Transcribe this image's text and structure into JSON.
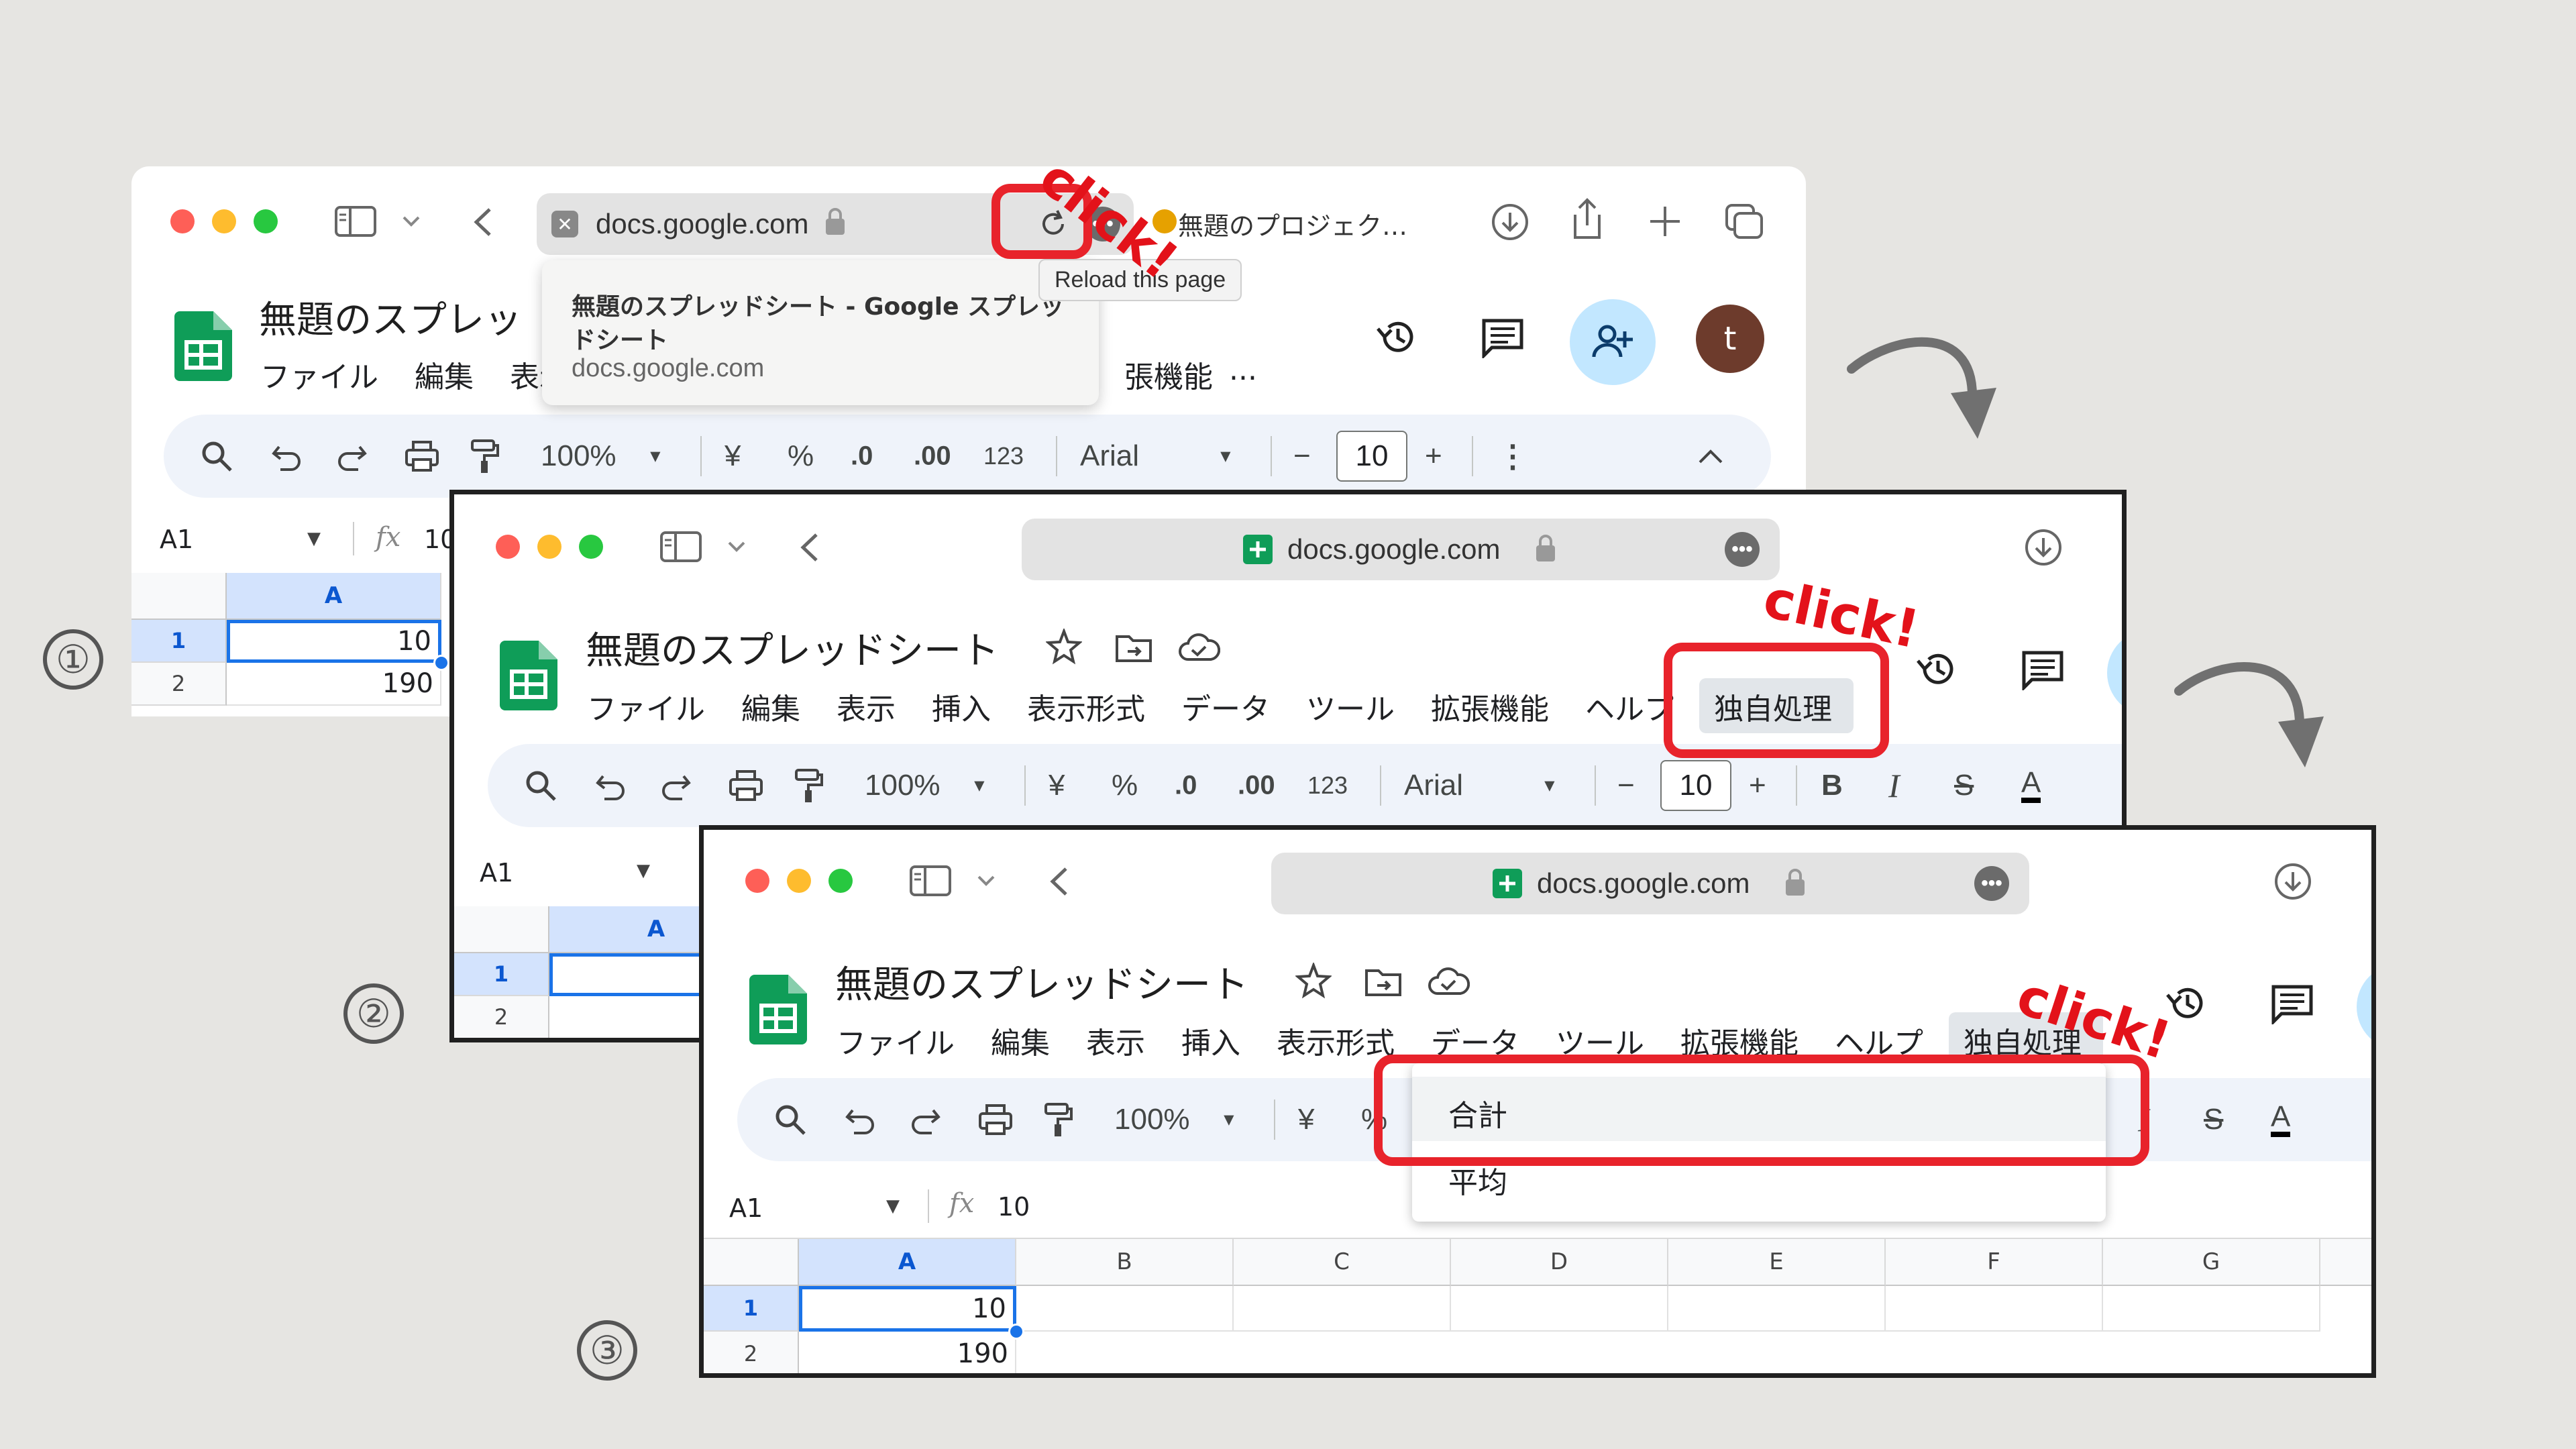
{
  "address": {
    "domain": "docs.google.com"
  },
  "window1": {
    "tab_title": "無題のプロジェク…",
    "popup": {
      "title_line1": "無題のスプレッドシート - Google スプレッ",
      "title_line2": "ドシート",
      "url": "docs.google.com"
    },
    "tooltip": "Reload this page",
    "doc_title": "無題のスプレッ",
    "menu_visible": [
      "ファイル",
      "編集",
      "表示"
    ],
    "menu_right": "張機能",
    "menu_ellipsis": "...",
    "avatar_letter": "t",
    "cell_ref": "A1",
    "formula_value": "10"
  },
  "doc": {
    "title": "無題のスプレッドシート",
    "menu": [
      "ファイル",
      "編集",
      "表示",
      "挿入",
      "表示形式",
      "データ",
      "ツール",
      "拡張機能",
      "ヘルプ",
      "独自処理"
    ],
    "menu_partial_help": "ヘルプ"
  },
  "toolbar": {
    "zoom": "100%",
    "currency": "¥",
    "percent": "%",
    "dec_decrease": ".0",
    "dec_increase": ".00",
    "number_format": "123",
    "font": "Arial",
    "minus": "−",
    "font_size": "10",
    "plus": "+",
    "bold": "B",
    "italic": "I",
    "strike": "S",
    "text_color": "A"
  },
  "sheet": {
    "cell_ref": "A1",
    "fx": "fx",
    "formula_value": "10",
    "columns": [
      "A",
      "B",
      "C",
      "D",
      "E",
      "F",
      "G"
    ],
    "rows": [
      {
        "num": "1",
        "a": "10"
      },
      {
        "num": "2",
        "a": "190"
      }
    ]
  },
  "dropdown": {
    "items": [
      "合計",
      "平均"
    ]
  },
  "annotations": {
    "click": "click!",
    "steps": [
      "①",
      "②",
      "③"
    ]
  },
  "colors": {
    "highlight": "#e8232b",
    "sheets_green": "#0f9d58",
    "selection_blue": "#1a73e8",
    "avatar_brown": "#6d3b2c",
    "share_blue": "#c2e7ff"
  }
}
